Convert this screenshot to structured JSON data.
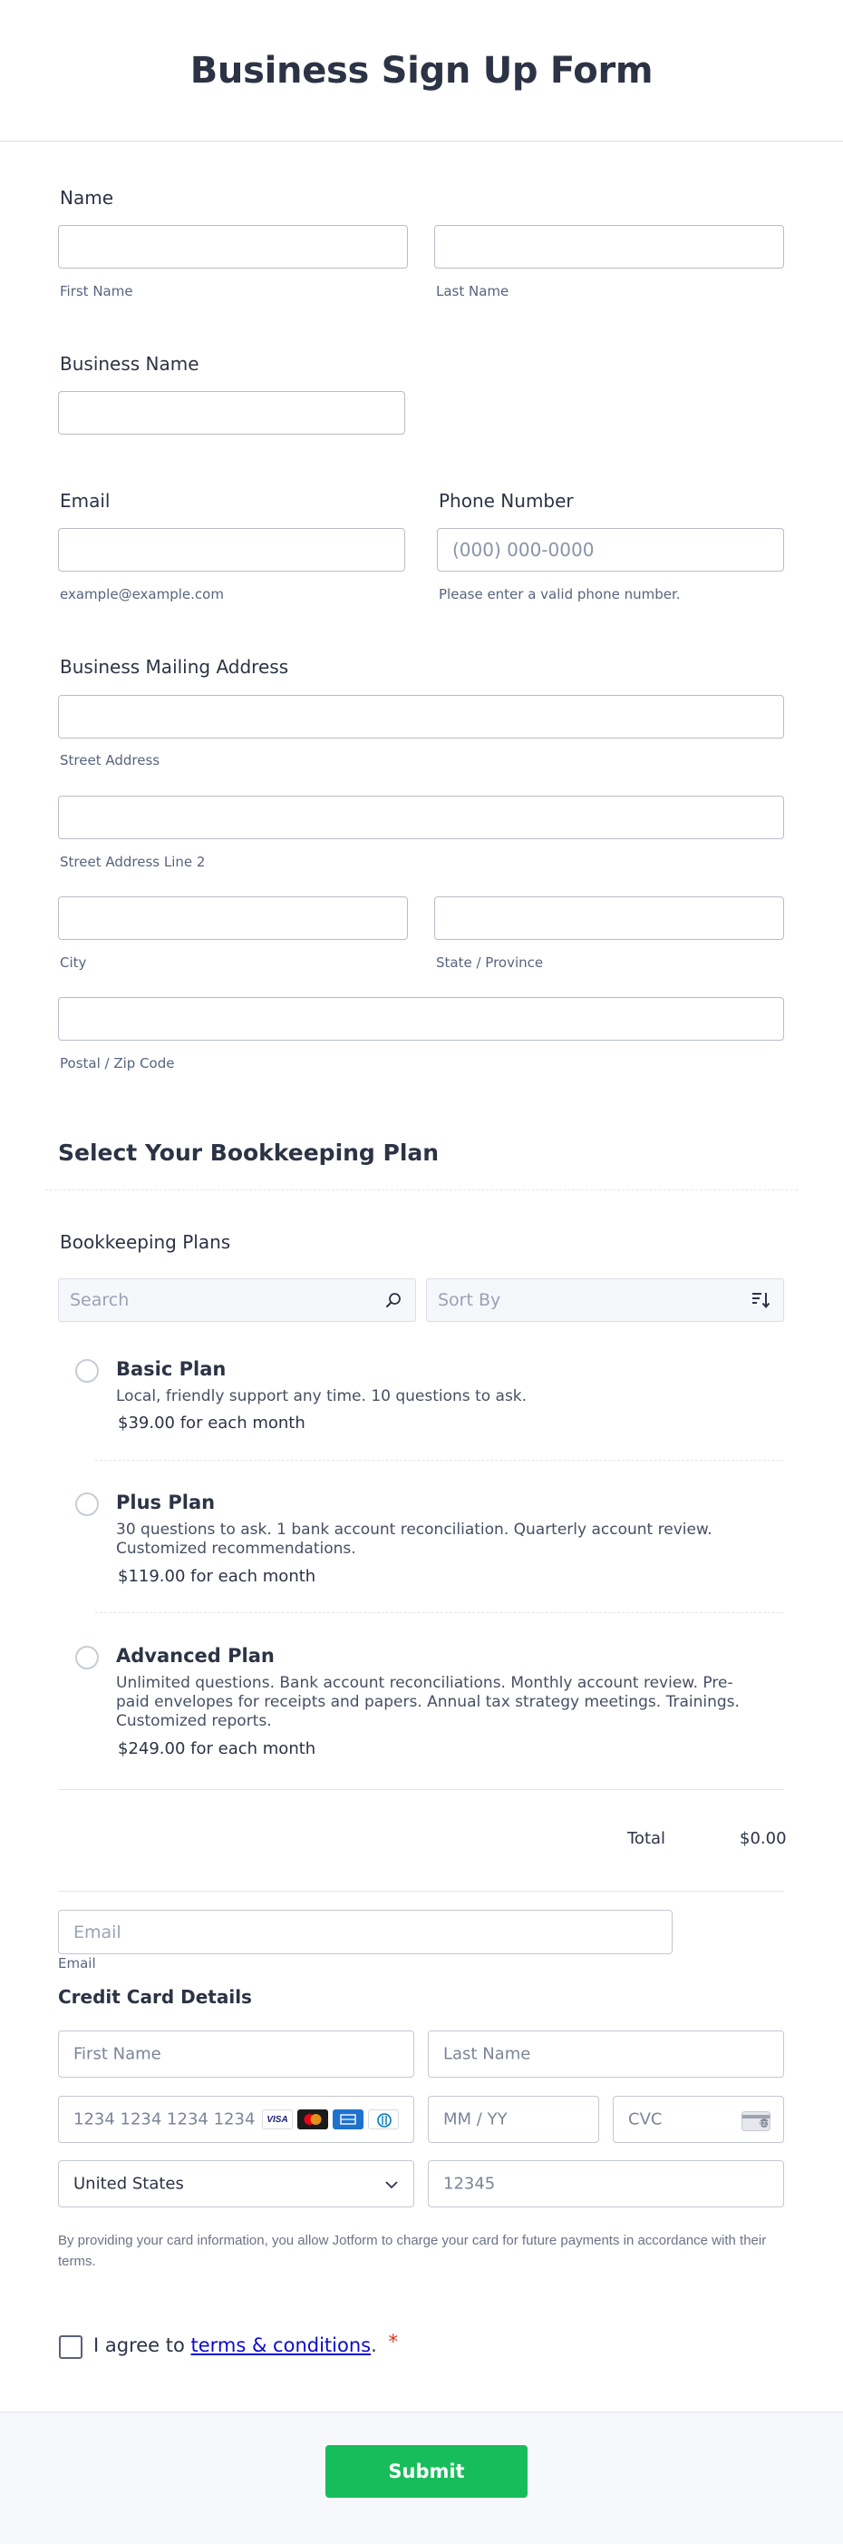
{
  "form_title": "Business Sign Up Form",
  "name": {
    "label": "Name",
    "first_sublabel": "First Name",
    "last_sublabel": "Last Name"
  },
  "business_name": {
    "label": "Business Name"
  },
  "email": {
    "label": "Email",
    "sublabel": "example@example.com"
  },
  "phone": {
    "label": "Phone Number",
    "placeholder": "(000) 000-0000",
    "sublabel": "Please enter a valid phone number."
  },
  "address": {
    "label": "Business Mailing Address",
    "street_sublabel": "Street Address",
    "street2_sublabel": "Street Address Line 2",
    "city_sublabel": "City",
    "state_sublabel": "State / Province",
    "zip_sublabel": "Postal / Zip Code"
  },
  "plan_section": {
    "title": "Select Your Bookkeeping Plan"
  },
  "plans": {
    "label": "Bookkeeping Plans",
    "search_placeholder": "Search",
    "sort_placeholder": "Sort By",
    "items": [
      {
        "name": "Basic Plan",
        "desc_lines": [
          "Local, friendly support any time. 10 questions to ask."
        ],
        "price": "$39.00",
        "period": "for each month"
      },
      {
        "name": "Plus Plan",
        "desc_lines": [
          "30 questions to ask. 1 bank account reconciliation. Quarterly account review.",
          "Customized recommendations."
        ],
        "price": "$119.00",
        "period": "for each month"
      },
      {
        "name": "Advanced Plan",
        "desc_lines": [
          "Unlimited questions. Bank account reconciliations. Monthly account review. Pre-",
          "paid envelopes for receipts and papers. Annual tax strategy meetings. Trainings.",
          "Customized reports."
        ],
        "price": "$249.00",
        "period": "for each month"
      }
    ],
    "total_label": "Total",
    "total_value": "$0.00"
  },
  "payment": {
    "email_placeholder": "Email",
    "email_sublabel": "Email",
    "title": "Credit Card Details",
    "first_name_placeholder": "First Name",
    "last_name_placeholder": "Last Name",
    "card_placeholder": "1234 1234 1234 1234",
    "card_brands": [
      "VISA",
      "mastercard",
      "amex",
      "diners"
    ],
    "expiry_placeholder": "MM / YY",
    "cvc_placeholder": "CVC",
    "country_value": "United States",
    "zip_placeholder": "12345",
    "disclaimer_line1": "By providing your card information, you allow Jotform to charge your card for future payments in accordance with their",
    "disclaimer_line2": "terms."
  },
  "terms": {
    "prefix": "I agree to ",
    "link_text": "terms & conditions",
    "suffix": ".",
    "required_mark": "*"
  },
  "submit_label": "Submit",
  "colors": {
    "submit": "#18bd5b",
    "link": "#0b0bd1",
    "required": "#e52d20"
  }
}
